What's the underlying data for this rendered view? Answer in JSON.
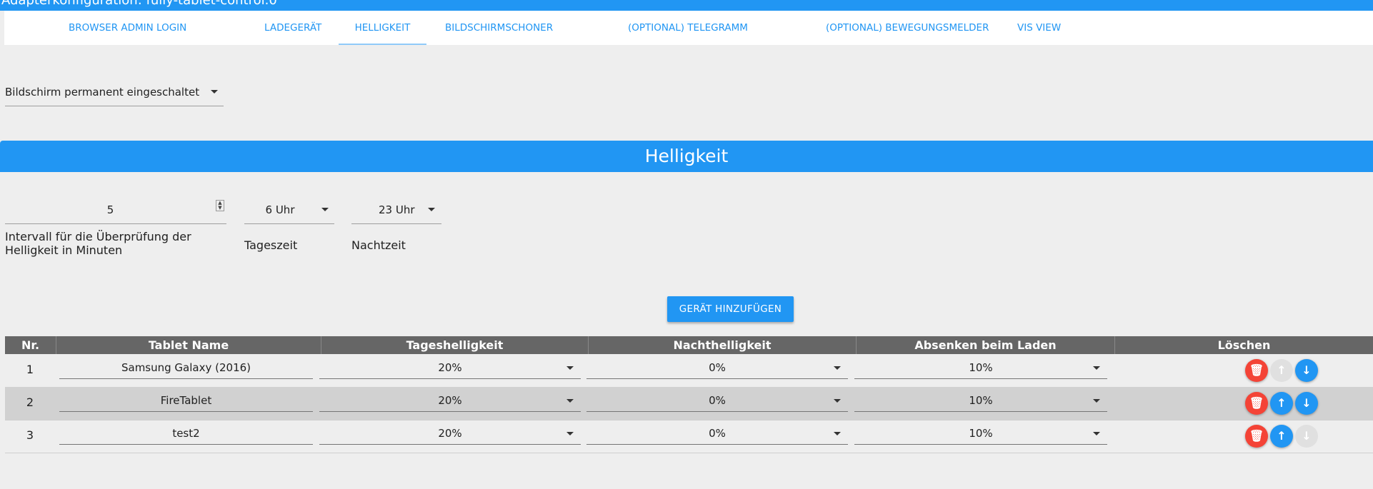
{
  "window": {
    "title": "Adapterkonfiguration: fully-tablet-control.0"
  },
  "tabs": [
    {
      "label": "Browser Admin Login",
      "active": false
    },
    {
      "label": "Ladegerät",
      "active": false
    },
    {
      "label": "Helligkeit",
      "active": true
    },
    {
      "label": "Bildschirmschoner",
      "active": false
    },
    {
      "label": "(Optional) Telegramm",
      "active": false
    },
    {
      "label": "(Optional) Bewegungsmelder",
      "active": false
    },
    {
      "label": "VIS View",
      "active": false
    }
  ],
  "screen_mode": {
    "value": "Bildschirm permanent eingeschaltet"
  },
  "section": {
    "title": "Helligkeit"
  },
  "interval": {
    "value": "5",
    "label": "Intervall für die Überprüfung der Helligkeit in Minuten"
  },
  "day_time": {
    "value": "6 Uhr",
    "label": "Tageszeit"
  },
  "night_time": {
    "value": "23 Uhr",
    "label": "Nachtzeit"
  },
  "add_button": {
    "label": "Gerät hinzufügen"
  },
  "table": {
    "headers": [
      "Nr.",
      "Tablet Name",
      "Tageshelligkeit",
      "Nachthelligkeit",
      "Absenken beim Laden",
      "Löschen"
    ],
    "rows": [
      {
        "nr": "1",
        "name": "Samsung Galaxy (2016)",
        "day": "20%",
        "night": "0%",
        "charging": "10%",
        "up_enabled": false,
        "down_enabled": true
      },
      {
        "nr": "2",
        "name": "FireTablet",
        "day": "20%",
        "night": "0%",
        "charging": "10%",
        "up_enabled": true,
        "down_enabled": true
      },
      {
        "nr": "3",
        "name": "test2",
        "day": "20%",
        "night": "0%",
        "charging": "10%",
        "up_enabled": true,
        "down_enabled": false
      }
    ]
  },
  "icons": {
    "delete": "trash-icon",
    "up": "arrow-up-icon",
    "down": "arrow-down-icon"
  },
  "colors": {
    "accent": "#2196f3",
    "danger": "#f44336",
    "header": "#666666"
  }
}
